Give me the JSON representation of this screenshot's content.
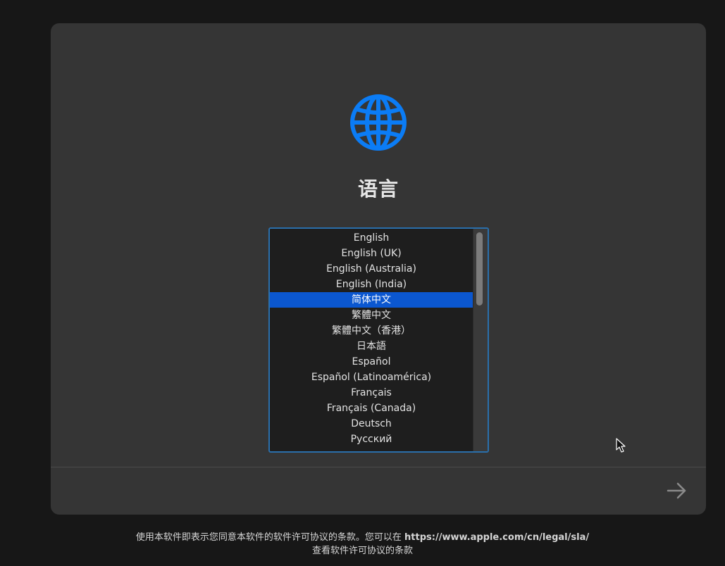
{
  "colors": {
    "background": "#171717",
    "panel": "#353535",
    "accent_blue": "#0b7cf5",
    "selection": "#0b57d0"
  },
  "setup": {
    "icon": "globe-icon",
    "title": "语言"
  },
  "language_list": {
    "items": [
      "English",
      "English (UK)",
      "English (Australia)",
      "English (India)",
      "简体中文",
      "繁體中文",
      "繁體中文（香港）",
      "日本語",
      "Español",
      "Español (Latinoamérica)",
      "Français",
      "Français (Canada)",
      "Deutsch",
      "Русский"
    ],
    "selected_index": 4
  },
  "navigation": {
    "next_icon": "arrow-right-icon"
  },
  "footer": {
    "line1_text": "使用本软件即表示您同意本软件的软件许可协议的条款。您可以在 ",
    "url": "https://www.apple.com/cn/legal/sla/",
    "line2_text": "查看软件许可协议的条款"
  }
}
